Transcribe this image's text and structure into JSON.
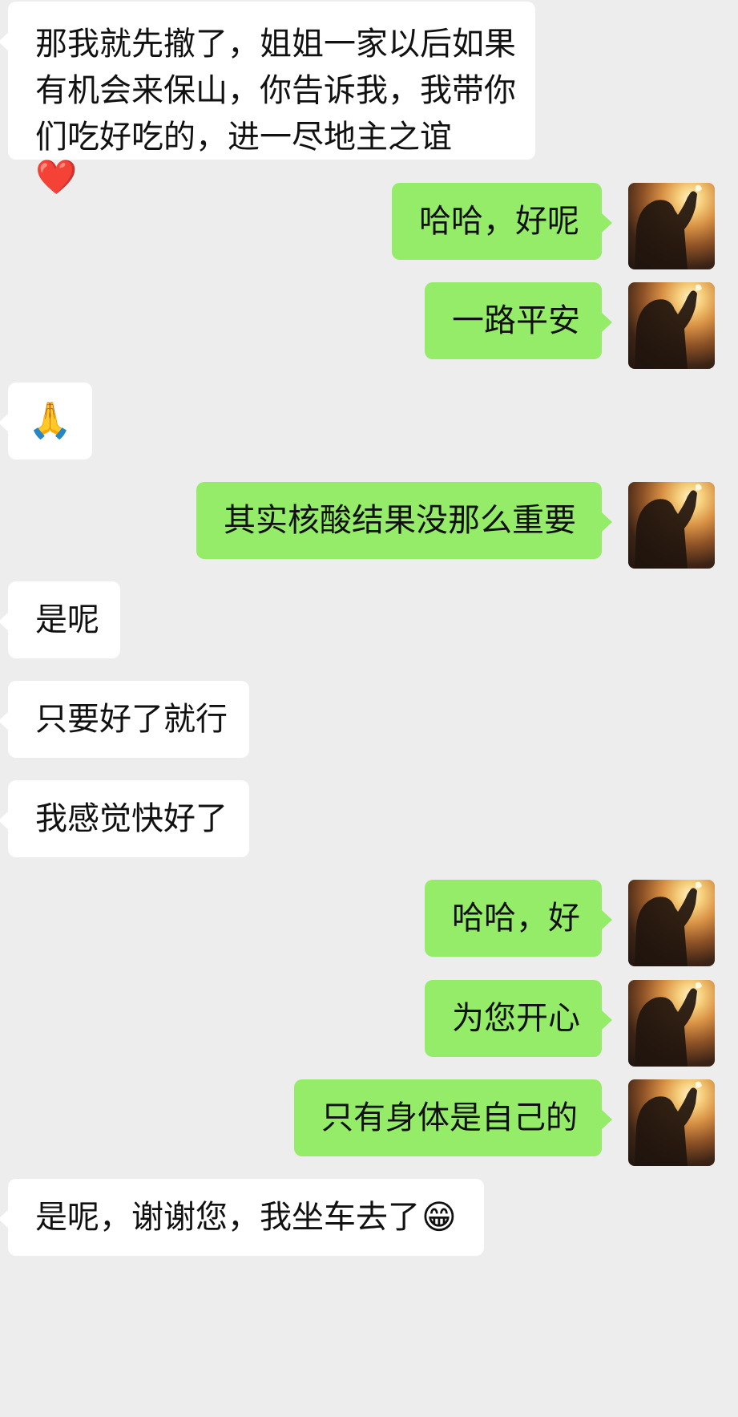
{
  "chat": {
    "messages": [
      {
        "sender": "other",
        "text_lines": [
          "那我就先撤了，姐姐一家以后如果",
          "有机会来保山，你告诉我，我带你",
          "们吃好吃的，进一尽地主之谊"
        ],
        "emoji": "❤️"
      },
      {
        "sender": "self",
        "text": "哈哈，好呢",
        "avatar": "user-avatar"
      },
      {
        "sender": "self",
        "text": "一路平安",
        "avatar": "user-avatar"
      },
      {
        "sender": "other",
        "emoji": "🙏"
      },
      {
        "sender": "self",
        "text": "其实核酸结果没那么重要",
        "avatar": "user-avatar"
      },
      {
        "sender": "other",
        "text": "是呢"
      },
      {
        "sender": "other",
        "text": "只要好了就行"
      },
      {
        "sender": "other",
        "text": "我感觉快好了"
      },
      {
        "sender": "self",
        "text": "哈哈，好",
        "avatar": "user-avatar"
      },
      {
        "sender": "self",
        "text": "为您开心",
        "avatar": "user-avatar"
      },
      {
        "sender": "self",
        "text": "只有身体是自己的",
        "avatar": "user-avatar"
      },
      {
        "sender": "other",
        "text": "是呢，谢谢您，我坐车去了",
        "emoji": "😁"
      }
    ]
  },
  "colors": {
    "background": "#ededed",
    "incoming_bubble": "#ffffff",
    "outgoing_bubble": "#95ec69"
  }
}
